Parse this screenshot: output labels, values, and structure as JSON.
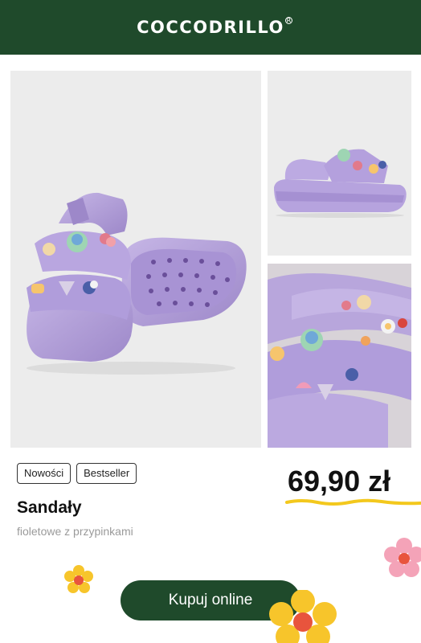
{
  "header": {
    "brand": "COCCODRILLO",
    "reg_mark": "R"
  },
  "gallery": {
    "main_image_alt": "",
    "top_image_alt": "",
    "bottom_image_alt": ""
  },
  "product": {
    "tags": [
      "Nowości",
      "Bestseller"
    ],
    "title": "Sandały",
    "subtitle": "fioletowe z przypinkami",
    "price": "69,90 zł"
  },
  "actions": {
    "buy_label": "Kupuj online"
  },
  "colors": {
    "brand_green": "#1f4a2b",
    "sandal_purple": "#b8a6dc",
    "price_underline": "#f3c81d",
    "flower_yellow": "#f7c52b",
    "flower_pink": "#f4a3b8",
    "flower_center": "#e8543d"
  }
}
